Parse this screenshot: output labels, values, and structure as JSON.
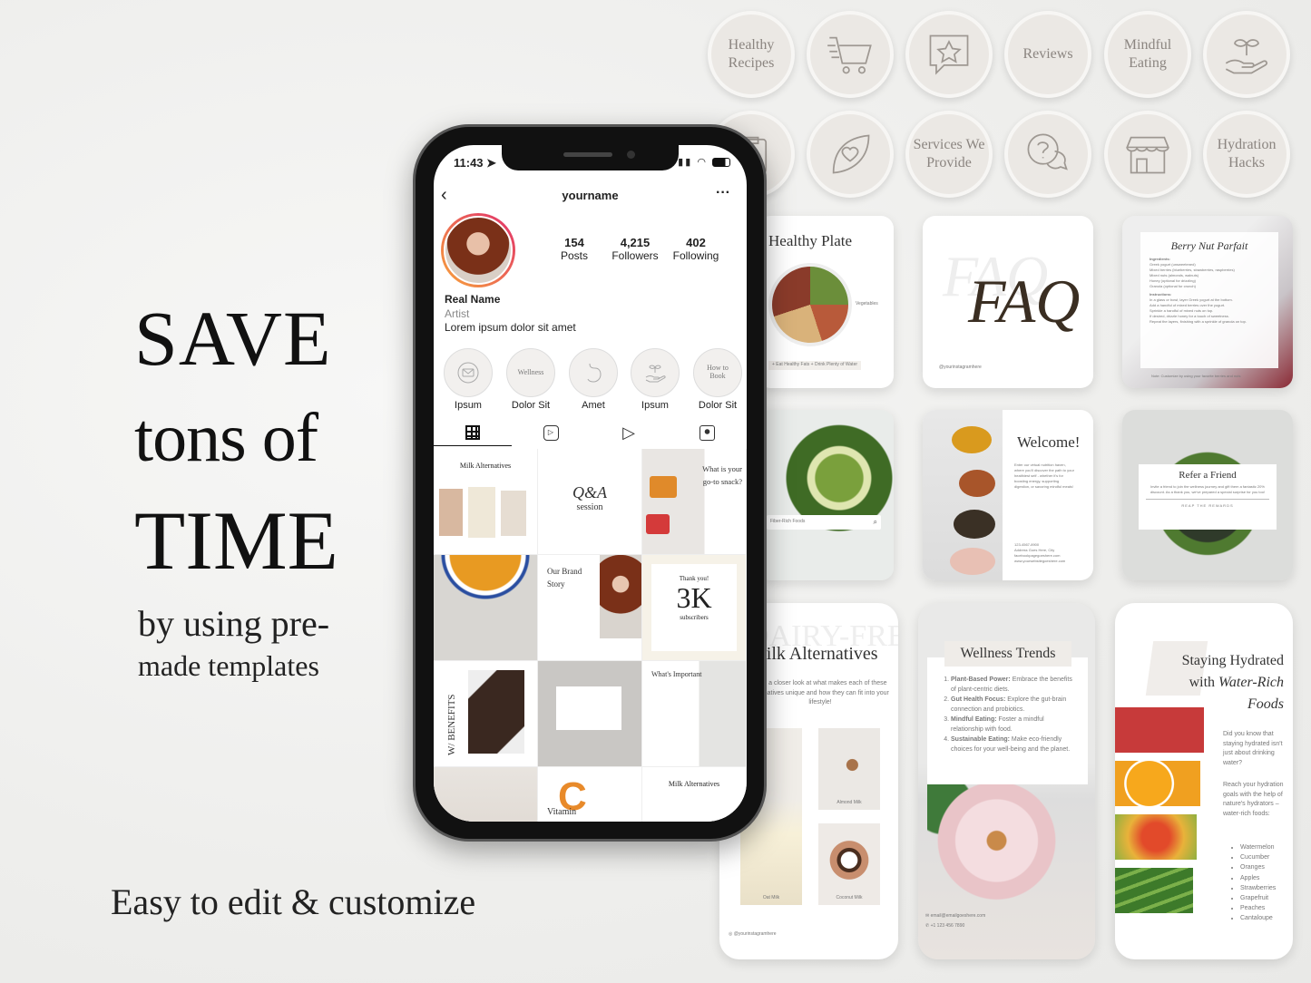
{
  "promo": {
    "line1": "SAVE",
    "line2": "tons of",
    "line3": "TIME",
    "line4": "by using pre-",
    "line5": "made templates",
    "tagline": "Easy to edit & customize"
  },
  "highlight_covers": [
    {
      "label": "Healthy Recipes",
      "icon": null
    },
    {
      "label": "",
      "icon": "shopping-cart-icon"
    },
    {
      "label": "",
      "icon": "star-chat-icon"
    },
    {
      "label": "Reviews",
      "icon": null
    },
    {
      "label": "Mindful Eating",
      "icon": null
    },
    {
      "label": "",
      "icon": "plant-hand-icon"
    },
    {
      "label": "",
      "icon": "clipboard-icon"
    },
    {
      "label": "",
      "icon": "heart-leaf-icon"
    },
    {
      "label": "Services We Provide",
      "icon": null
    },
    {
      "label": "",
      "icon": "question-chat-icon"
    },
    {
      "label": "",
      "icon": "shop-icon"
    },
    {
      "label": "Hydration Hacks",
      "icon": null
    }
  ],
  "phone": {
    "time": "11:43",
    "username": "yourname",
    "stats": [
      {
        "value": "154",
        "label": "Posts"
      },
      {
        "value": "4,215",
        "label": "Followers"
      },
      {
        "value": "402",
        "label": "Following"
      }
    ],
    "name": "Real Name",
    "category": "Artist",
    "bio": "Lorem ipsum dolor sit amet",
    "highlights": [
      {
        "label": "Ipsum",
        "cover": "",
        "icon": "mail-icon"
      },
      {
        "label": "Dolor Sit",
        "cover": "Wellness",
        "icon": null
      },
      {
        "label": "Amet",
        "cover": "",
        "icon": "stomach-icon"
      },
      {
        "label": "Ipsum",
        "cover": "",
        "icon": "plant-hand-icon"
      },
      {
        "label": "Dolor Sit",
        "cover": "How to Book",
        "icon": null
      }
    ],
    "tabs": [
      "grid-icon",
      "reels-icon",
      "play-icon",
      "tagged-icon"
    ],
    "grid": {
      "milk_title": "Milk Alternatives",
      "qa_title": "Q&A",
      "qa_sub": "session",
      "snack": "What is your go-to snack?",
      "brand": "Our Brand Story",
      "thanks": "Thank you!",
      "thanks_number": "3K",
      "thanks_sub": "subscribers",
      "benefits": "W/ BENEFITS",
      "important": "What's Important",
      "vitamin": "Vitamin",
      "vitamin_letter": "C",
      "milk_title_2": "Milk Alternatives"
    }
  },
  "cards": {
    "healthy_plate": {
      "title": "Healthy Plate",
      "caption": "+ Eat Healthy Fats + Drink Plenty of Water",
      "tag": "Vegetables"
    },
    "faq": {
      "title": "FAQ",
      "handle": "@yourinstagramhere"
    },
    "parfait": {
      "title": "Berry Nut Parfait",
      "ingredients_label": "Ingredients:",
      "ingredients": [
        "Greek yogurt (unsweetened)",
        "Mixed berries (blueberries, strawberries, raspberries)",
        "Mixed nuts (almonds, walnuts)",
        "Honey (optional for drizzling)",
        "Granola (optional for crunch)"
      ],
      "instructions_label": "Instructions:",
      "instructions": [
        "In a glass or bowl, layer Greek yogurt at the bottom.",
        "Add a handful of mixed berries over the yogurt.",
        "Sprinkle a handful of mixed nuts on top.",
        "If desired, drizzle honey for a touch of sweetness.",
        "Repeat the layers, finishing with a sprinkle of granola on top."
      ],
      "note": "Note: Customize by using your favorite berries and nuts"
    },
    "fiber": {
      "search": "Fiber-Rich Foods"
    },
    "welcome": {
      "title": "Welcome!",
      "body": "Enter our virtual nutrition haven, where you'll discover the path to your healthiest self - whether it's for boosting energy, supporting digestion, or savoring mindful meals!",
      "contact": [
        "123-4567-8900",
        "Address Goes Here, City",
        "facebookpagegoeshere.com",
        "www.yourwebsitegoeshere.com"
      ]
    },
    "refer": {
      "title": "Refer a Friend",
      "body": "Invite a friend to join the wellness journey and gift them a fantastic 20% discount. As a thank you, we've prepared a special surprise for you too!",
      "cta": "REAP THE REWARDS"
    },
    "milk": {
      "ghost": "DAIRY-FREE",
      "title": "Milk Alternatives",
      "body": "Take a closer look at what makes each of these alternatives unique and how they can fit into your lifestyle!",
      "items": [
        "Oat Milk",
        "Almond Milk",
        "Coconut Milk"
      ],
      "handle": "@yourinstagramhere"
    },
    "wellness": {
      "title": "Wellness Trends",
      "items": [
        {
          "bold": "Plant-Based Power:",
          "text": " Embrace the benefits of plant-centric diets."
        },
        {
          "bold": "Gut Health Focus:",
          "text": " Explore the gut-brain connection and probiotics."
        },
        {
          "bold": "Mindful Eating:",
          "text": " Foster a mindful relationship with food."
        },
        {
          "bold": "Sustainable Eating:",
          "text": " Make eco-friendly choices for your well-being and the planet."
        }
      ],
      "email": "email@emailgoeshere.com",
      "phone": "+1 123 456 7890"
    },
    "hydrated": {
      "title1": "Staying Hydrated",
      "title2": "with",
      "title3": "Water-Rich",
      "title4": "Foods",
      "p1": "Did you know that staying hydrated isn't just about drinking water?",
      "p2": "Reach your hydration goals with the help of nature's hydrators – water-rich foods:",
      "foods": [
        "Watermelon",
        "Cucumber",
        "Oranges",
        "Apples",
        "Strawberries",
        "Grapefruit",
        "Peaches",
        "Cantaloupe"
      ]
    }
  }
}
